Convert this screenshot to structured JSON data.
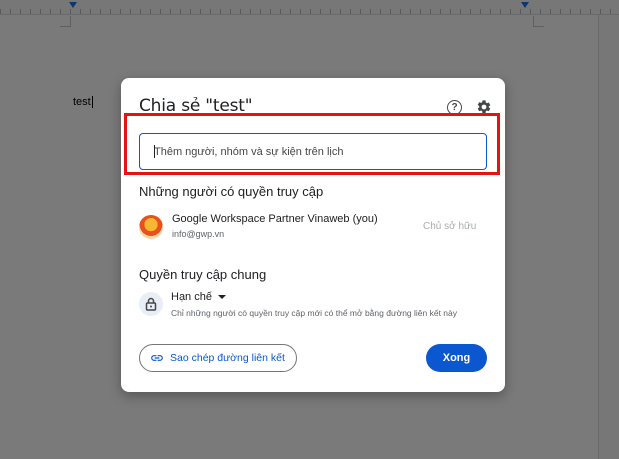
{
  "document": {
    "text": "test"
  },
  "dialog": {
    "title": "Chia sẻ \"test\"",
    "help_icon_glyph": "?",
    "add_people": {
      "placeholder": "Thêm người, nhóm và sự kiện trên lịch",
      "value": ""
    },
    "people_section": {
      "heading": "Những người có quyền truy cập",
      "people": [
        {
          "name": "Google Workspace Partner Vinaweb (you)",
          "email": "info@gwp.vn",
          "role": "Chủ sở hữu"
        }
      ]
    },
    "general_access": {
      "heading": "Quyền truy cập chung",
      "selected": "Hạn chế",
      "description": "Chỉ những người có quyền truy cập mới có thể mở bằng đường liên kết này"
    },
    "copy_link_label": "Sao chép đường liên kết",
    "done_label": "Xong"
  },
  "colors": {
    "accent": "#0b57d0",
    "highlight_frame": "#e31414"
  },
  "icons": [
    "help-icon",
    "gear-icon",
    "lock-icon",
    "link-icon",
    "chevron-down-icon"
  ]
}
